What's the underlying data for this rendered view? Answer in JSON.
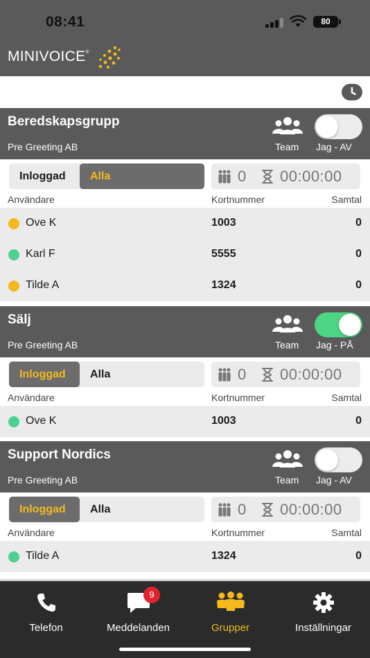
{
  "status_bar": {
    "time": "08:41",
    "battery": "80"
  },
  "header": {
    "logo_text": "MINIVOICE",
    "logo_mark": "®",
    "brand_color": "#f5b91e"
  },
  "history": {
    "icon": "clock-icon"
  },
  "columns": {
    "user": "Användare",
    "card": "Kortnummer",
    "calls": "Samtal"
  },
  "groups": [
    {
      "title": "Beredskapsgrupp",
      "company": "Pre Greeting AB",
      "team_label": "Team",
      "toggle_label": "Jag - AV",
      "toggle_on": false,
      "filter": {
        "logged_in": "Inloggad",
        "all": "Alla",
        "active": "all"
      },
      "stats": {
        "count": "0",
        "timer": "00:00:00"
      },
      "rows": [
        {
          "name": "Ove K",
          "card": "1003",
          "calls": "0",
          "status_color": "#f5b91e"
        },
        {
          "name": "Karl F",
          "card": "5555",
          "calls": "0",
          "status_color": "#4cd18f"
        },
        {
          "name": "Tilde A",
          "card": "1324",
          "calls": "0",
          "status_color": "#f5b91e"
        }
      ]
    },
    {
      "title": "Sälj",
      "company": "Pre Greeting AB",
      "team_label": "Team",
      "toggle_label": "Jag - PÅ",
      "toggle_on": true,
      "filter": {
        "logged_in": "Inloggad",
        "all": "Alla",
        "active": "logged_in"
      },
      "stats": {
        "count": "0",
        "timer": "00:00:00"
      },
      "rows": [
        {
          "name": "Ove K",
          "card": "1003",
          "calls": "0",
          "status_color": "#4cd18f"
        }
      ]
    },
    {
      "title": "Support Nordics",
      "company": "Pre Greeting AB",
      "team_label": "Team",
      "toggle_label": "Jag - AV",
      "toggle_on": false,
      "filter": {
        "logged_in": "Inloggad",
        "all": "Alla",
        "active": "logged_in"
      },
      "stats": {
        "count": "0",
        "timer": "00:00:00"
      },
      "rows": [
        {
          "name": "Tilde A",
          "card": "1324",
          "calls": "0",
          "status_color": "#4cd18f"
        }
      ]
    }
  ],
  "tabs": [
    {
      "label": "Telefon",
      "icon": "phone-icon",
      "active": false
    },
    {
      "label": "Meddelanden",
      "icon": "message-icon",
      "badge": "9",
      "active": false
    },
    {
      "label": "Grupper",
      "icon": "group-icon",
      "active": true
    },
    {
      "label": "Inställningar",
      "icon": "gear-icon",
      "active": false
    }
  ]
}
